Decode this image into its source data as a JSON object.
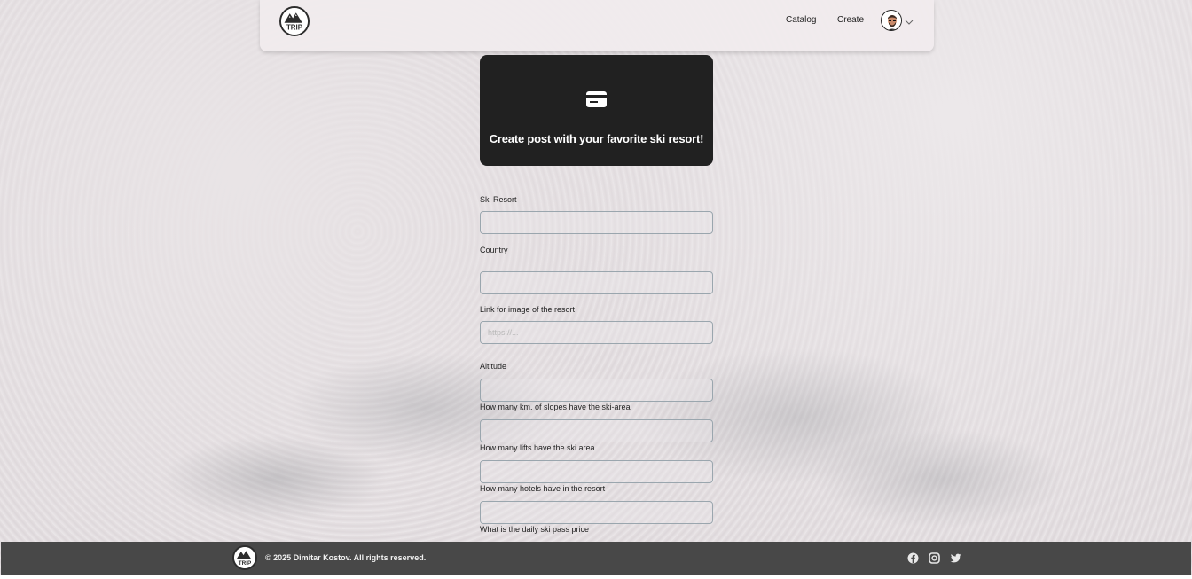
{
  "nav": {
    "catalog_label": "Catalog",
    "create_label": "Create",
    "logo_text": "TRIP"
  },
  "hero": {
    "icon": "card-icon",
    "title": "Create post with your favorite ski resort!"
  },
  "form": {
    "fields": [
      {
        "label": "Ski Resort",
        "value": "",
        "placeholder": ""
      },
      {
        "label": "Country",
        "value": "",
        "placeholder": ""
      },
      {
        "label": "Link for image of the resort",
        "value": "",
        "placeholder": "https://..."
      },
      {
        "label": "Altitude",
        "value": "",
        "placeholder": ""
      },
      {
        "label": "How many km. of slopes have the ski-area",
        "value": "",
        "placeholder": ""
      },
      {
        "label": "How many lifts have the ski area",
        "value": "",
        "placeholder": ""
      },
      {
        "label": "How many hotels have in the resort",
        "value": "",
        "placeholder": ""
      },
      {
        "label": "What is the daily ski pass price",
        "value": "",
        "placeholder": ""
      }
    ]
  },
  "footer": {
    "copyright": "© 2025 Dimitar Kostov. All rights reserved.",
    "social_icons": [
      "facebook-icon",
      "instagram-icon",
      "twitter-icon"
    ]
  },
  "colors": {
    "hero_bg": "#212121",
    "footer_bg": "#484848",
    "input_border": "#9aa6ae"
  }
}
